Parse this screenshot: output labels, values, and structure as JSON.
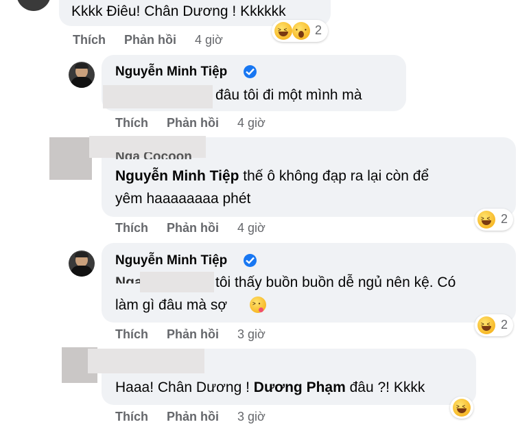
{
  "comments": [
    {
      "text": "Kkkk Điêu! Chân Dương ! Kkkkkk",
      "actions": {
        "like": "Thích",
        "reply": "Phản hồi",
        "time": "4 giờ"
      },
      "reaction_count": "2"
    },
    {
      "author": "Nguyễn Minh Tiệp",
      "text": "đâu tôi đi một mình mà",
      "actions": {
        "like": "Thích",
        "reply": "Phản hồi",
        "time": "4 giờ"
      }
    },
    {
      "partial_name": "Nga Cocoon",
      "mention": "Nguyễn Minh Tiệp",
      "text_line1": "thế ô không đạp ra lại còn để",
      "text_line2": "yêm haaaaaaaa phét",
      "actions": {
        "like": "Thích",
        "reply": "Phản hồi",
        "time": "4 giờ"
      },
      "reaction_count": "2"
    },
    {
      "author": "Nguyễn Minh Tiệp",
      "partial_mention": "Nga C",
      "text_line1": "tôi thấy buồn buồn dễ ngủ nên kệ. Có",
      "text_line2": "làm gì đâu mà sợ",
      "actions": {
        "like": "Thích",
        "reply": "Phản hồi",
        "time": "3 giờ"
      },
      "reaction_count": "2"
    },
    {
      "text_pre": "Haaa! Chân Dương !",
      "mention": "Dương Phạm",
      "text_post": "đâu ?! Kkkk",
      "actions": {
        "like": "Thích",
        "reply": "Phản hồi",
        "time": "3 giờ"
      }
    }
  ],
  "colors": {
    "bubble": "#f0f2f5",
    "meta": "#65676b",
    "verified": "#1877f2",
    "text": "#050505"
  },
  "icons": [
    "verified-badge-icon",
    "haha-emoji-icon",
    "wow-emoji-icon",
    "tongue-wink-emoji-icon"
  ]
}
